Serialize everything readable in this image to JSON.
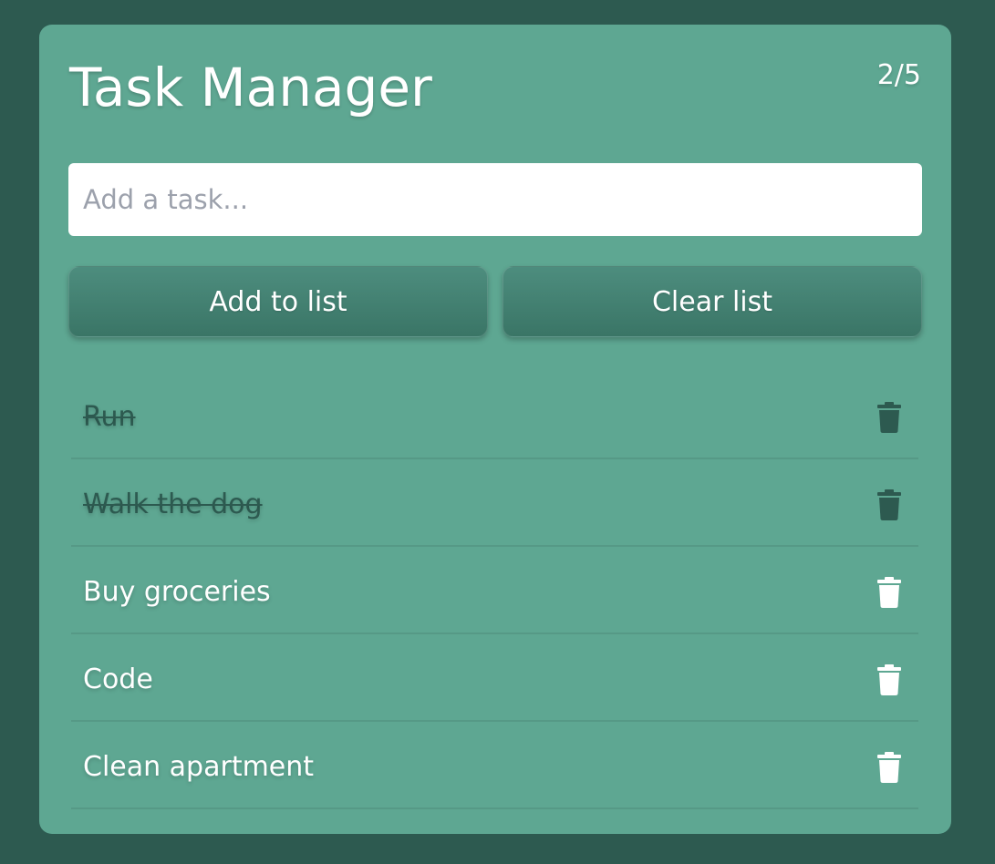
{
  "app": {
    "title": "Task Manager",
    "counter": "2/5"
  },
  "input": {
    "placeholder": "Add a task...",
    "value": ""
  },
  "buttons": {
    "add_label": "Add to list",
    "clear_label": "Clear list"
  },
  "tasks": [
    {
      "label": "Run",
      "completed": true,
      "icon": "trash-icon"
    },
    {
      "label": "Walk the dog",
      "completed": true,
      "icon": "trash-icon"
    },
    {
      "label": "Buy groceries",
      "completed": false,
      "icon": "trash-icon"
    },
    {
      "label": "Code",
      "completed": false,
      "icon": "trash-icon"
    },
    {
      "label": "Clean apartment",
      "completed": false,
      "icon": "trash-icon"
    }
  ],
  "colors": {
    "page_background": "#2d5a50",
    "card_background": "#5ea792",
    "button_background": "#3f7d6e",
    "completed_text": "#2d5a50",
    "active_text": "#ffffff"
  }
}
